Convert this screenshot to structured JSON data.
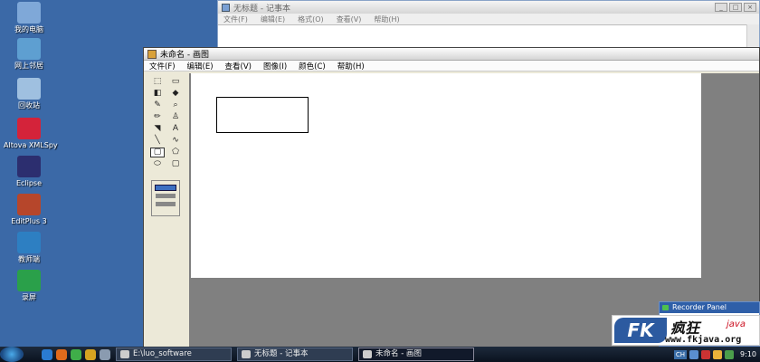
{
  "desktop": {
    "icons": [
      {
        "label": "我的电脑",
        "icon": "computer-icon",
        "color": "#7fa8d8"
      },
      {
        "label": "网上邻居",
        "icon": "network-icon",
        "color": "#5e9fd1"
      },
      {
        "label": "回收站",
        "icon": "recycle-bin-icon",
        "color": "#9fc0e0"
      },
      {
        "label": "Altova XMLSpy",
        "icon": "xmlspy-icon",
        "color": "#d4233a"
      },
      {
        "label": "Eclipse",
        "icon": "eclipse-icon",
        "color": "#2c2e6f"
      },
      {
        "label": "EditPlus 3",
        "icon": "editplus-icon",
        "color": "#b6462b"
      },
      {
        "label": "教师端",
        "icon": "teacher-icon",
        "color": "#2d7fc2"
      },
      {
        "label": "录屏",
        "icon": "recorder-icon",
        "color": "#2aa04a"
      }
    ]
  },
  "notepad": {
    "title": "无标题 - 记事本",
    "menu": [
      "文件(F)",
      "编辑(E)",
      "格式(O)",
      "查看(V)",
      "帮助(H)"
    ]
  },
  "paint": {
    "title": "未命名 - 画图",
    "menu": [
      "文件(F)",
      "编辑(E)",
      "查看(V)",
      "图像(I)",
      "颜色(C)",
      "帮助(H)"
    ],
    "tools": [
      {
        "glyph": "⬚",
        "name": "free-select-icon"
      },
      {
        "glyph": "▭",
        "name": "select-icon"
      },
      {
        "glyph": "◧",
        "name": "eraser-icon"
      },
      {
        "glyph": "◆",
        "name": "fill-icon"
      },
      {
        "glyph": "✎",
        "name": "pick-color-icon"
      },
      {
        "glyph": "⌕",
        "name": "magnifier-icon"
      },
      {
        "glyph": "✏",
        "name": "pencil-icon"
      },
      {
        "glyph": "♙",
        "name": "brush-icon"
      },
      {
        "glyph": "◥",
        "name": "airbrush-icon"
      },
      {
        "glyph": "A",
        "name": "text-icon"
      },
      {
        "glyph": "╲",
        "name": "line-icon"
      },
      {
        "glyph": "∿",
        "name": "curve-icon"
      },
      {
        "glyph": "▢",
        "name": "rectangle-icon"
      },
      {
        "glyph": "⬠",
        "name": "polygon-icon"
      },
      {
        "glyph": "⬭",
        "name": "ellipse-icon"
      },
      {
        "glyph": "▢",
        "name": "rounded-rectangle-icon"
      }
    ],
    "selected_tool_index": 12
  },
  "recorder": {
    "title": "Recorder Panel"
  },
  "logo": {
    "fk": "FK",
    "cn": "疯狂",
    "en": "java",
    "url": "www.fkjava.org"
  },
  "taskbar": {
    "tasks": [
      {
        "label": "E:\\luo_software"
      },
      {
        "label": "无标题 - 记事本"
      },
      {
        "label": "未命名 - 画图"
      }
    ],
    "tray": {
      "ime": "CH",
      "clock": "9:10"
    }
  }
}
